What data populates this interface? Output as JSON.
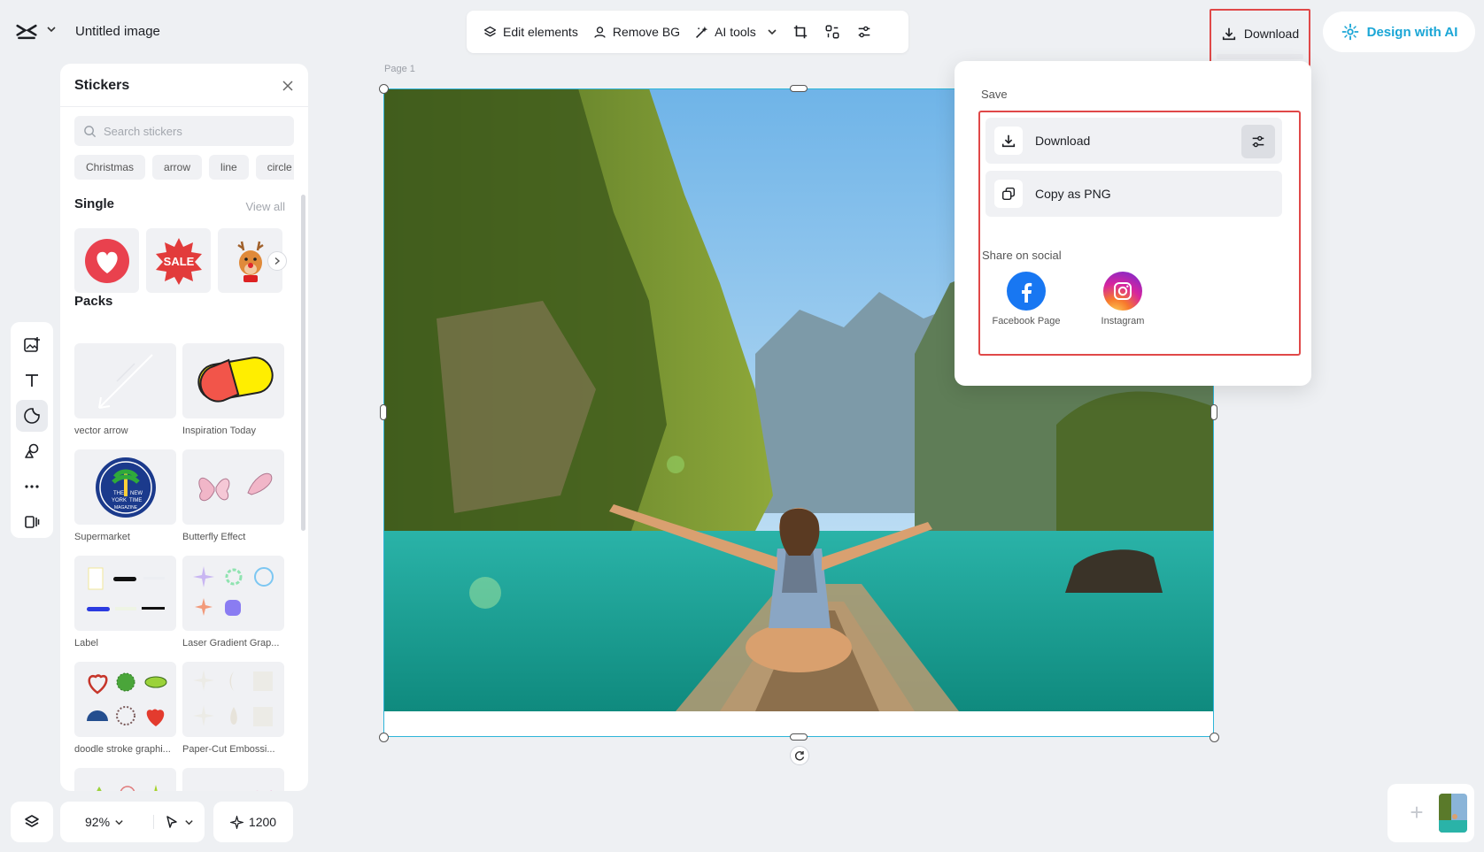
{
  "header": {
    "doc_title": "Untitled image",
    "toolbar": {
      "edit_elements": "Edit elements",
      "remove_bg": "Remove BG",
      "ai_tools": "AI tools"
    },
    "download_label": "Download",
    "design_ai_label": "Design with AI"
  },
  "panel": {
    "title": "Stickers",
    "search_placeholder": "Search stickers",
    "chips": [
      "Christmas",
      "arrow",
      "line",
      "circle"
    ],
    "single_title": "Single",
    "view_all": "View all",
    "single_items": [
      "heart",
      "SALE",
      "reindeer"
    ],
    "packs_title": "Packs",
    "packs": [
      {
        "label": "vector arrow"
      },
      {
        "label": "Inspiration Today"
      },
      {
        "label": "Supermarket"
      },
      {
        "label": "Butterfly Effect"
      },
      {
        "label": "Label"
      },
      {
        "label": "Laser Gradient Grap..."
      },
      {
        "label": "doodle stroke graphi..."
      },
      {
        "label": "Paper-Cut Embossi..."
      }
    ],
    "sale_text": "SALE",
    "badge_text": [
      "THE",
      "NEW",
      "YORK",
      "TIME",
      "MAGAZINE"
    ]
  },
  "canvas": {
    "page_label": "Page 1"
  },
  "bottom": {
    "zoom": "92%",
    "credits": "1200"
  },
  "dropdown": {
    "save_title": "Save",
    "download": "Download",
    "copy_png": "Copy as PNG",
    "share_title": "Share on social",
    "facebook": "Facebook Page",
    "instagram": "Instagram"
  },
  "colors": {
    "accent": "#2eb5d9",
    "highlight": "#e04848",
    "facebook": "#1877f2"
  }
}
